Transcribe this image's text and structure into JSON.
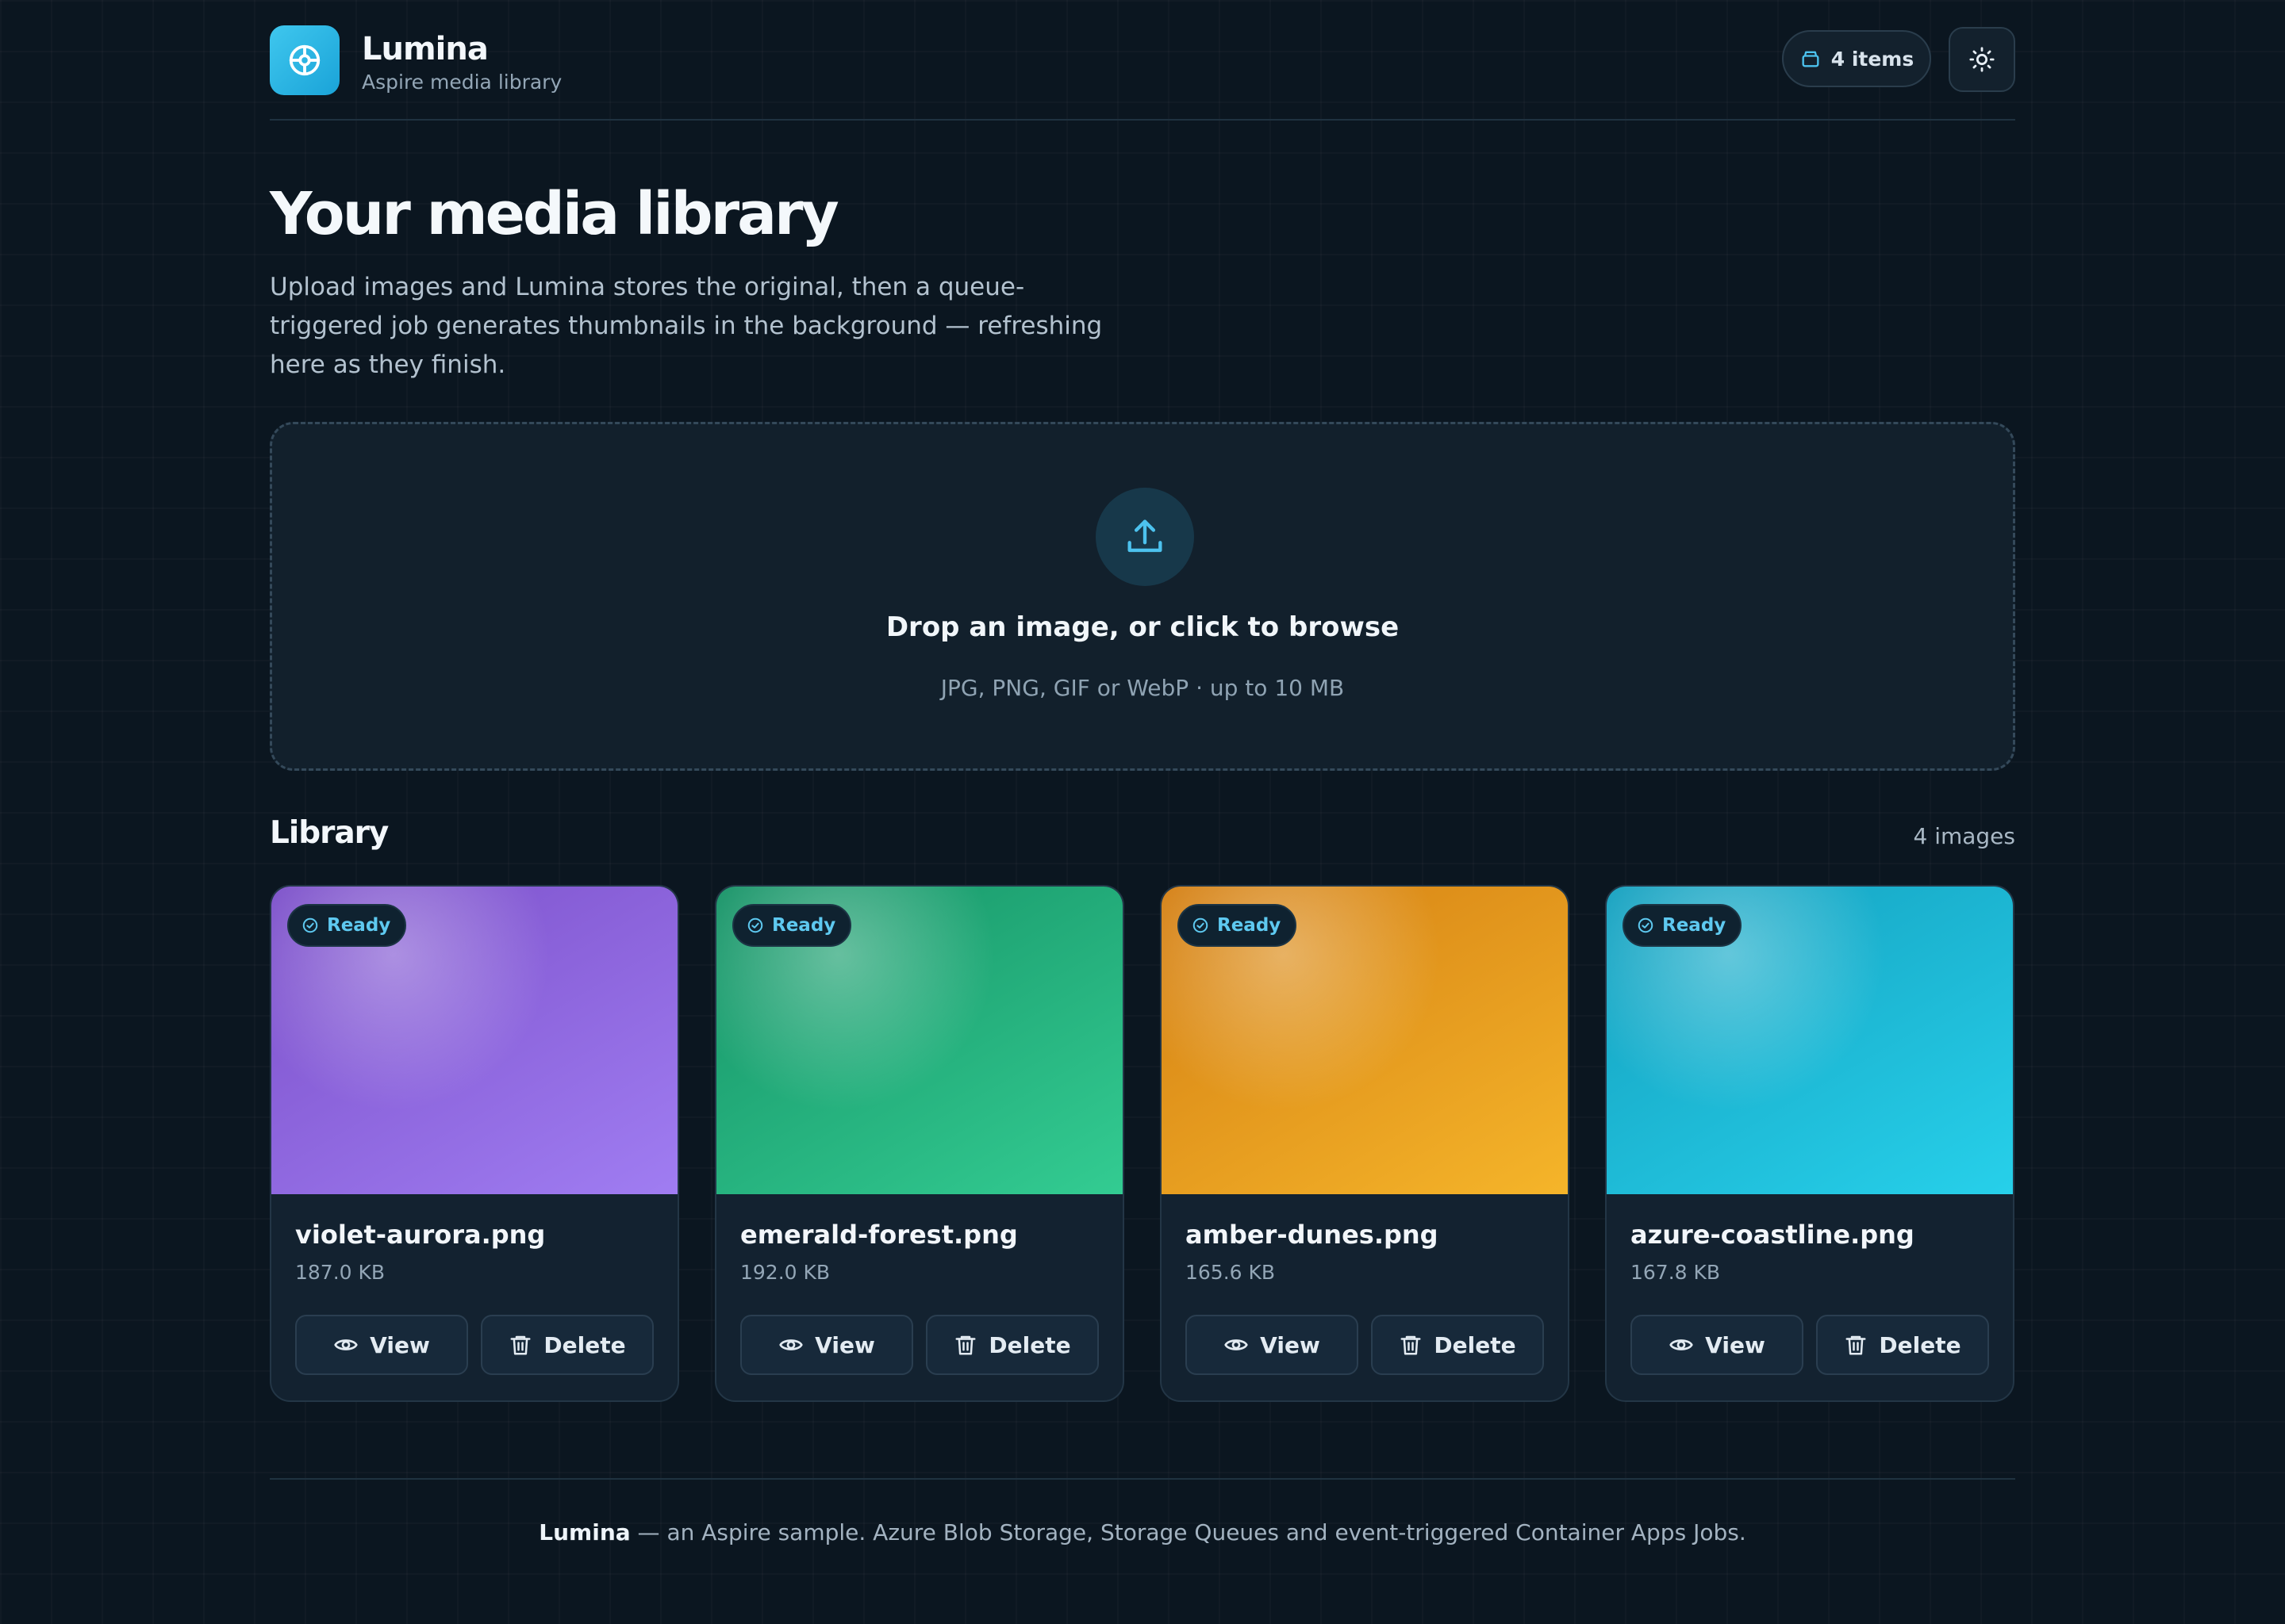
{
  "app": {
    "name": "Lumina",
    "subtitle": "Aspire media library",
    "items_badge": "4 items"
  },
  "hero": {
    "title": "Your media library",
    "lead": "Upload images and Lumina stores the original, then a queue-triggered job generates thumbnails in the background — refreshing here as they finish."
  },
  "dropzone": {
    "title": "Drop an image, or click to browse",
    "hint": "JPG, PNG, GIF or WebP · up to 10 MB"
  },
  "library": {
    "title": "Library",
    "count": "4 images",
    "images": [
      {
        "status": "Ready",
        "name": "violet-aurora.png",
        "size": "187.0 KB",
        "view_label": "View",
        "delete_label": "Delete",
        "colors": [
          "#7b4fc9",
          "#a07df2"
        ]
      },
      {
        "status": "Ready",
        "name": "emerald-forest.png",
        "size": "192.0 KB",
        "view_label": "View",
        "delete_label": "Delete",
        "colors": [
          "#169266",
          "#33cc92"
        ]
      },
      {
        "status": "Ready",
        "name": "amber-dunes.png",
        "size": "165.6 KB",
        "view_label": "View",
        "delete_label": "Delete",
        "colors": [
          "#d47f13",
          "#f5b52a"
        ]
      },
      {
        "status": "Ready",
        "name": "azure-coastline.png",
        "size": "167.8 KB",
        "view_label": "View",
        "delete_label": "Delete",
        "colors": [
          "#14a0bf",
          "#27d0ea"
        ]
      }
    ]
  },
  "footer": {
    "brand": "Lumina",
    "text": " — an Aspire sample. Azure Blob Storage, Storage Queues and event-triggered Container Apps Jobs."
  },
  "icons": {
    "logo": "crosshair-icon",
    "items": "stack-icon",
    "theme": "sun-icon",
    "upload": "upload-icon",
    "ready": "check-circle-icon",
    "view": "eye-icon",
    "delete": "trash-icon"
  },
  "colors": {
    "accent": "#29b6e6",
    "background": "#0b1620"
  }
}
